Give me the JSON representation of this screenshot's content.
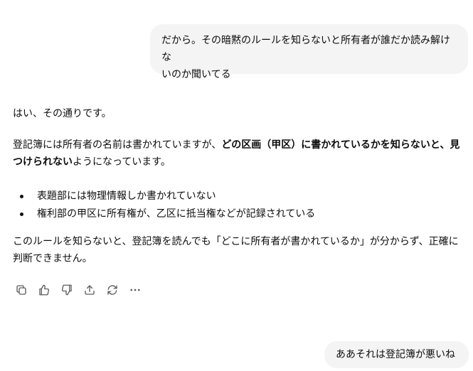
{
  "user_messages": [
    {
      "text_line1": "だから。その暗黙のルールを知らないと所有者が誰だか読み解けな",
      "text_line2": "いのか聞いてる"
    },
    {
      "text": "ああそれは登記簿が悪いね"
    }
  ],
  "assistant": {
    "p1": "はい、その通りです。",
    "p2_pre": "登記簿には所有者の名前は書かれていますが、",
    "p2_bold": "どの区画（甲区）に書かれているかを知らないと、見つけられない",
    "p2_post": "ようになっています。",
    "bullets": [
      "表題部には物理情報しか書かれていない",
      "権利部の甲区に所有権が、乙区に抵当権などが記録されている"
    ],
    "p3": "このルールを知らないと、登記簿を読んでも「どこに所有者が書かれているか」が分からず、正確に判断できません。"
  },
  "actions": [
    "copy-icon",
    "thumbs-up-icon",
    "thumbs-down-icon",
    "share-icon",
    "regenerate-icon",
    "more-icon"
  ]
}
